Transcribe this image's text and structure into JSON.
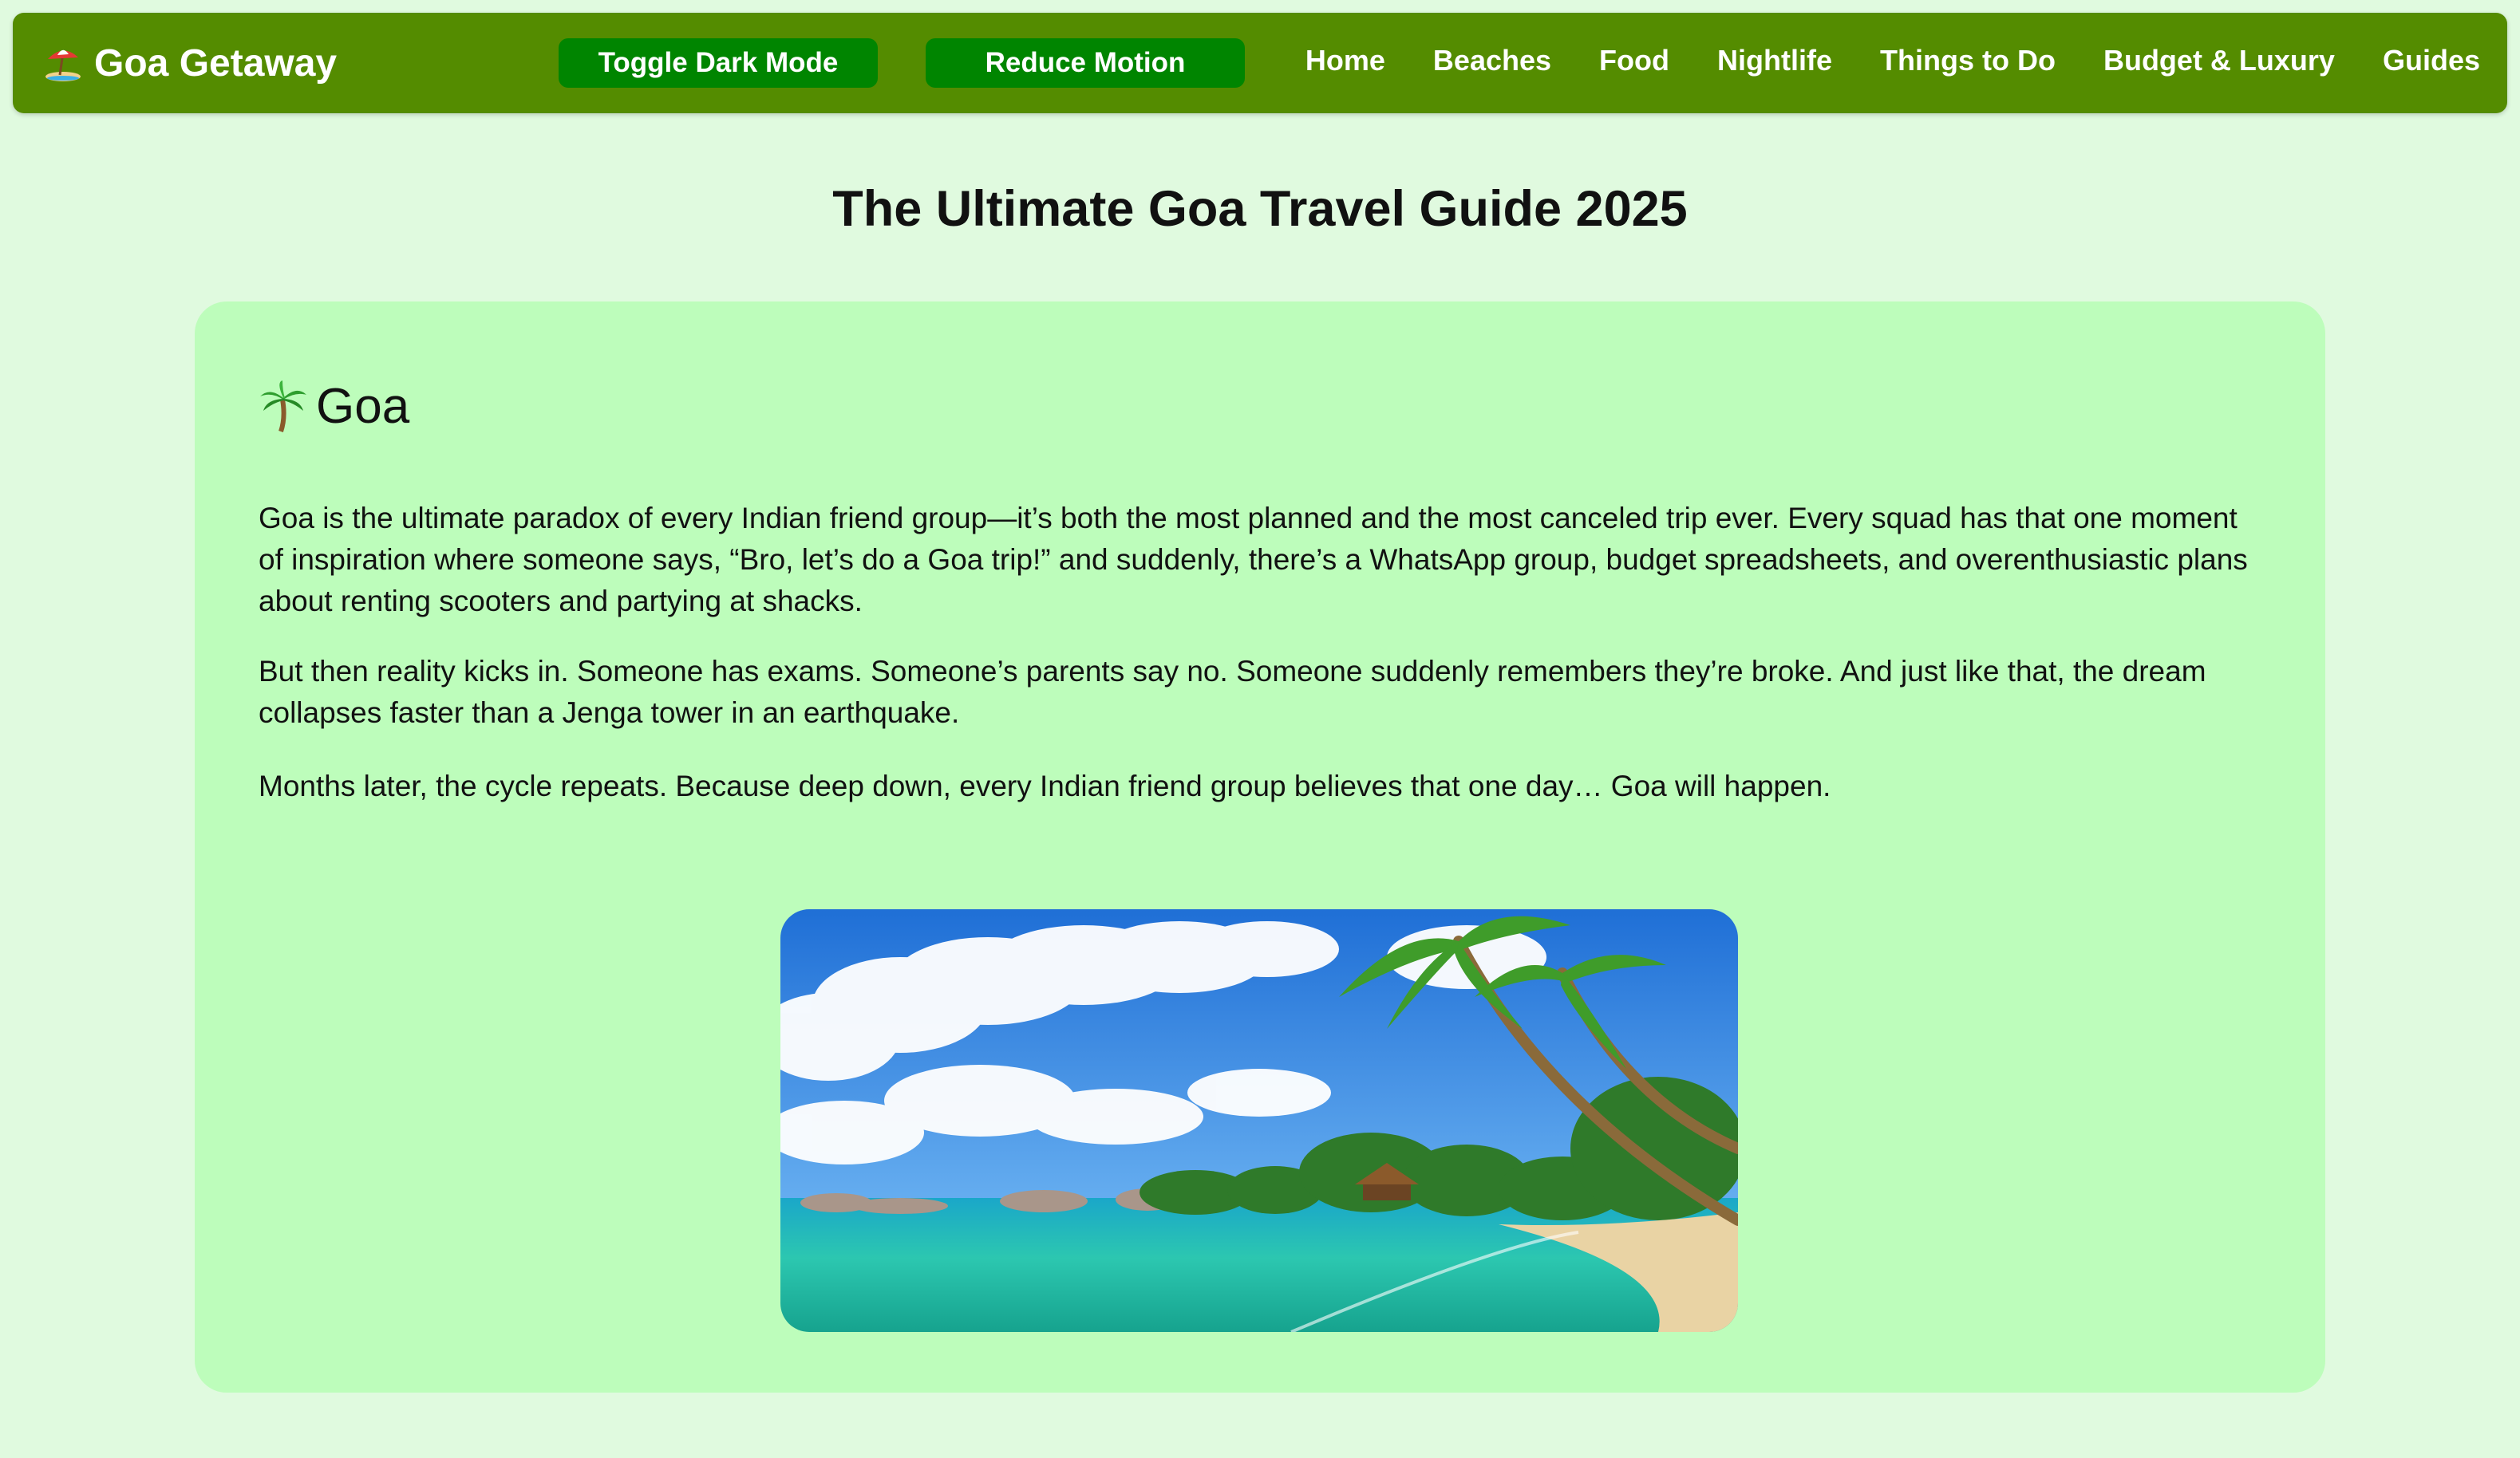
{
  "nav": {
    "brand": "Goa Getaway",
    "brand_icon": "beach-umbrella-icon",
    "buttons": {
      "dark_mode": "Toggle Dark Mode",
      "reduce_motion": "Reduce Motion"
    },
    "links": [
      "Home",
      "Beaches",
      "Food",
      "Nightlife",
      "Things to Do",
      "Budget & Luxury",
      "Guides"
    ]
  },
  "page": {
    "title": "The Ultimate Goa Travel Guide 2025"
  },
  "card": {
    "heading": "Goa",
    "heading_icon": "palm-tree-icon",
    "paragraphs": [
      "Goa is the ultimate paradox of every Indian friend group—it’s both the most planned and the most canceled trip ever. Every squad has that one moment of inspiration where someone says, “Bro, let’s do a Goa trip!” and suddenly, there’s a WhatsApp group, budget spreadsheets, and overenthusiastic plans about renting scooters and partying at shacks.",
      "But then reality kicks in. Someone has exams. Someone’s parents say no. Someone suddenly remembers they’re broke. And just like that, the dream collapses faster than a Jenga tower in an earthquake.",
      "Months later, the cycle repeats. Because deep down, every Indian friend group believes that one day… Goa will happen."
    ]
  },
  "colors": {
    "page_background": "#e0fadf",
    "navbar": "#548c00",
    "button": "#008500",
    "card": "#bdfdbb",
    "text": "#111111"
  }
}
